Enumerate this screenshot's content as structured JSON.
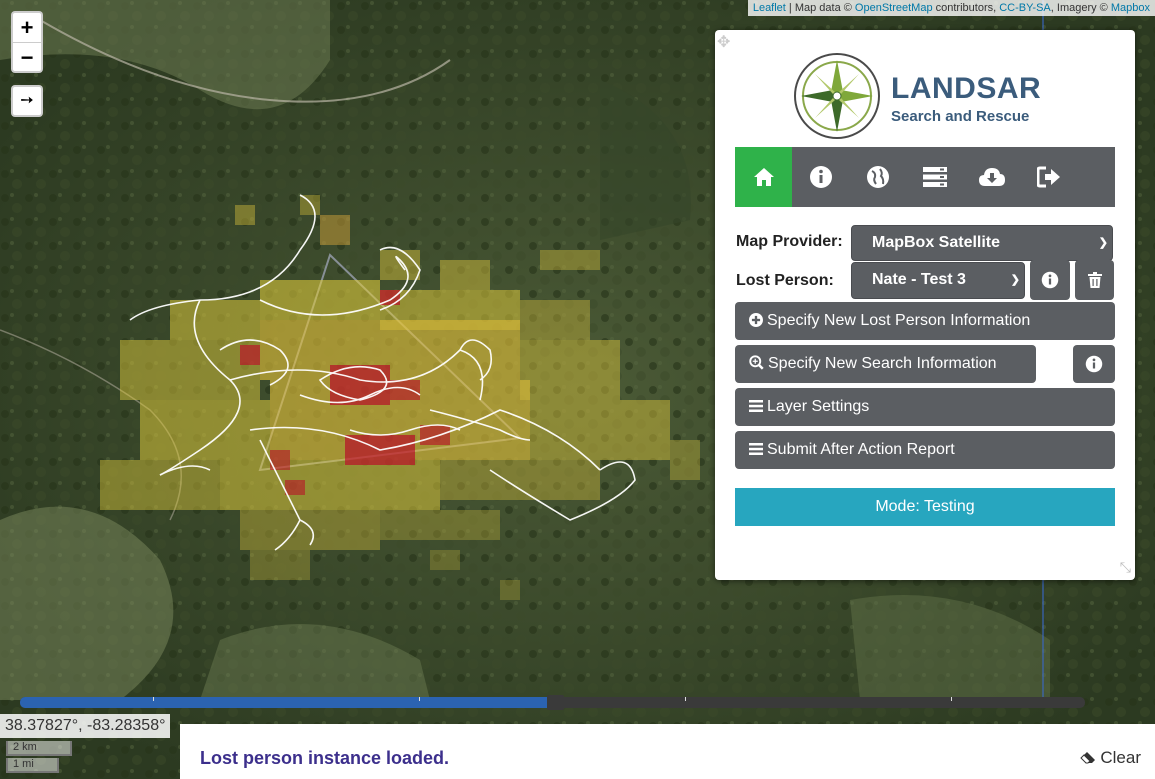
{
  "map": {
    "zoom_in_label": "+",
    "zoom_out_label": "−",
    "locate_label": "➙",
    "attribution": {
      "leaflet": "Leaflet",
      "sep1": " | Map data © ",
      "osm": "OpenStreetMap",
      "contrib": " contributors, ",
      "ccbysa": "CC-BY-SA",
      "imagery": ", Imagery © ",
      "mapbox": "Mapbox"
    },
    "coordinates": "38.37827°, -83.28358°",
    "scale_km": "2 km",
    "scale_mi": "1 mi",
    "timeline_progress": 0.5
  },
  "panel": {
    "logo_title": "LANDSAR",
    "logo_subtitle": "Search and Rescue",
    "tabs": [
      {
        "icon": "home-icon",
        "active": true
      },
      {
        "icon": "info-icon",
        "active": false
      },
      {
        "icon": "globe-icon",
        "active": false
      },
      {
        "icon": "server-icon",
        "active": false
      },
      {
        "icon": "cloud-download-icon",
        "active": false
      },
      {
        "icon": "sign-out-icon",
        "active": false
      }
    ],
    "map_provider_label": "Map Provider:",
    "map_provider_value": "MapBox Satellite",
    "lost_person_label": "Lost Person:",
    "lost_person_value": "Nate - Test 3",
    "btn_new_lost_person": "Specify New Lost Person Information",
    "btn_new_search": "Specify New Search Information",
    "btn_layer_settings": "Layer Settings",
    "btn_after_action": "Submit After Action Report",
    "mode": "Mode: Testing"
  },
  "status": {
    "message": "Lost person instance loaded.",
    "clear_label": "Clear"
  },
  "colors": {
    "tab_active": "#2fb24a",
    "button_gray": "#5b5e62",
    "mode_bar": "#27a6bf",
    "status_text": "#3c2f8c",
    "heat_yellow": "#e8d23a",
    "heat_red": "#c81e2a",
    "timeline_blue": "#2b63b1"
  }
}
